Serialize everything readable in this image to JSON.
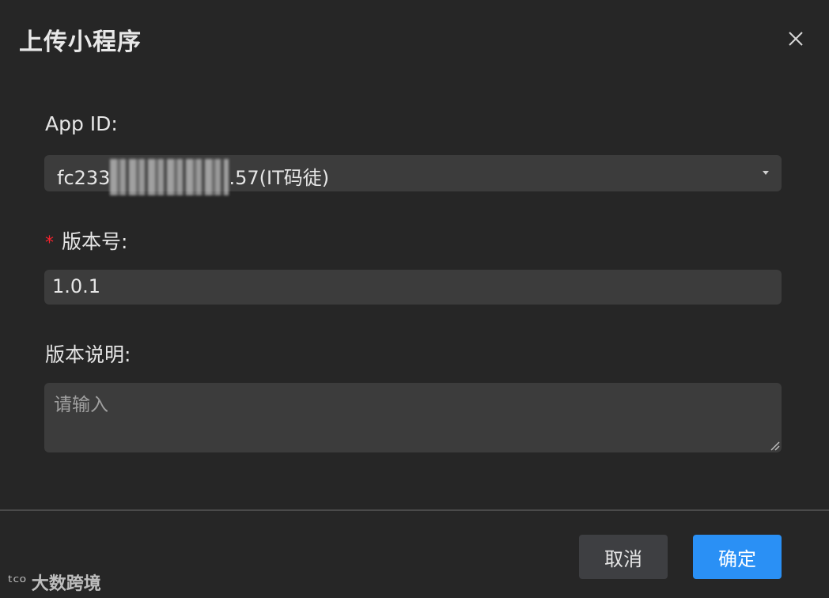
{
  "dialog": {
    "title": "上传小程序",
    "close_icon": "close-icon"
  },
  "form": {
    "app_id": {
      "label": "App ID:",
      "value_prefix": "fc233",
      "value_suffix": ".57(IT码徒)",
      "caret_icon": "caret-down-icon"
    },
    "version": {
      "required_mark": "*",
      "label": "版本号:",
      "value": "1.0.1"
    },
    "description": {
      "label": "版本说明:",
      "placeholder": "请输入",
      "value": ""
    }
  },
  "footer": {
    "cancel_label": "取消",
    "ok_label": "确定"
  },
  "watermark": {
    "logo": "ᵗᶜᵒ",
    "text": "大数跨境"
  },
  "colors": {
    "background": "#262626",
    "field_bg": "#3c3c3c",
    "primary": "#2a90f5",
    "required": "#f5222d"
  }
}
